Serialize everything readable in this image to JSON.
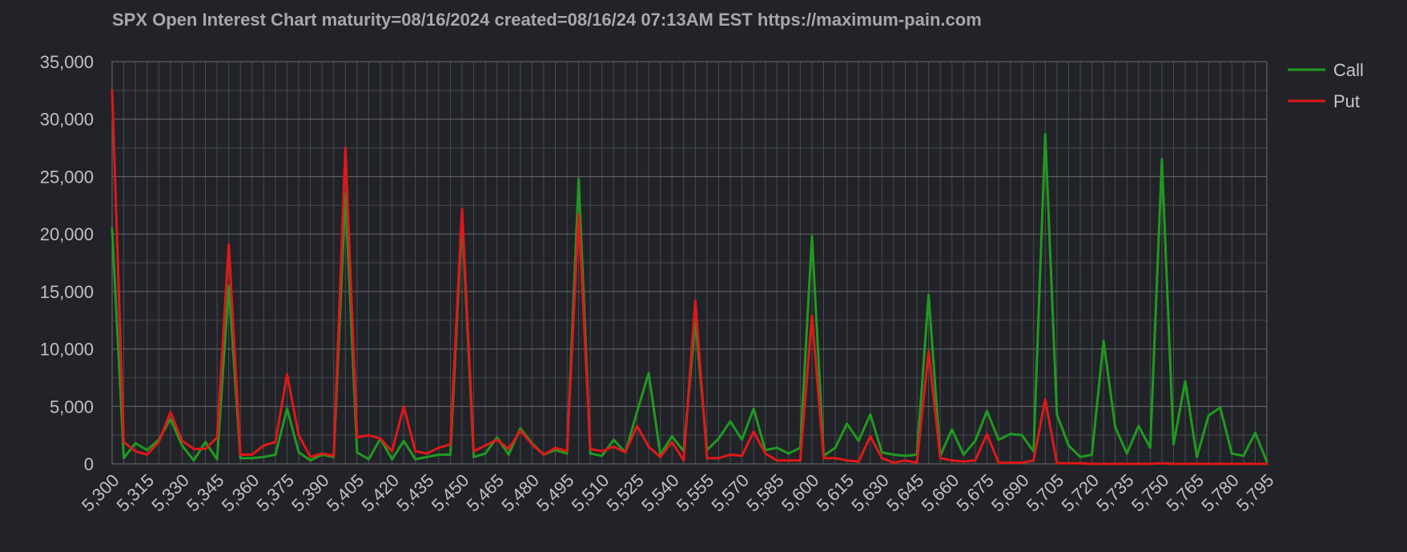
{
  "chart_data": {
    "type": "line",
    "title": "SPX Open Interest Chart maturity=08/16/2024 created=08/16/24 07:13AM EST https://maximum-pain.com",
    "xlabel": "",
    "ylabel": "",
    "ylim": [
      0,
      35000
    ],
    "y_ticks": [
      0,
      5000,
      10000,
      15000,
      20000,
      25000,
      30000,
      35000
    ],
    "x_start": 5300,
    "x_step": 5,
    "x_end": 5795,
    "x_tick_every": 15,
    "grid": true,
    "legend_position": "top-right",
    "series": [
      {
        "name": "Call",
        "color": "#1f9a1f",
        "values": [
          20500,
          500,
          1800,
          1200,
          2100,
          3900,
          1600,
          300,
          1900,
          400,
          15500,
          500,
          500,
          600,
          800,
          4800,
          1000,
          300,
          800,
          600,
          23500,
          1000,
          400,
          2200,
          400,
          2000,
          400,
          600,
          800,
          800,
          21500,
          600,
          900,
          2300,
          800,
          3100,
          1800,
          800,
          1200,
          900,
          24800,
          900,
          700,
          2100,
          1000,
          4500,
          7900,
          800,
          2400,
          1100,
          12500,
          1200,
          2200,
          3700,
          2100,
          4800,
          1200,
          1400,
          900,
          1400,
          19800,
          700,
          1400,
          3500,
          2000,
          4300,
          1000,
          800,
          700,
          800,
          14700,
          700,
          3000,
          800,
          2000,
          4600,
          2100,
          2600,
          2500,
          1100,
          28700,
          4300,
          1600,
          600,
          800,
          10700,
          3200,
          900,
          3300,
          1400,
          26500,
          1700,
          7200,
          600,
          4200,
          4900,
          900,
          700,
          2700,
          200
        ]
      },
      {
        "name": "Put",
        "color": "#e01818",
        "values": [
          32500,
          1900,
          1100,
          800,
          1900,
          4500,
          2000,
          1300,
          1300,
          2300,
          19100,
          800,
          800,
          1600,
          1900,
          7800,
          2500,
          600,
          900,
          700,
          27500,
          2300,
          2500,
          2200,
          1100,
          5000,
          1100,
          900,
          1400,
          1700,
          22200,
          1100,
          1600,
          2100,
          1300,
          2900,
          1700,
          800,
          1400,
          1100,
          21700,
          1300,
          1100,
          1500,
          1000,
          3300,
          1500,
          600,
          1900,
          300,
          14200,
          500,
          500,
          800,
          700,
          2800,
          900,
          300,
          300,
          300,
          12900,
          500,
          500,
          300,
          200,
          2400,
          500,
          100,
          300,
          100,
          9800,
          500,
          300,
          200,
          300,
          2600,
          100,
          100,
          100,
          300,
          5600,
          50,
          50,
          50,
          0,
          0,
          0,
          0,
          0,
          0,
          50,
          0,
          0,
          0,
          0,
          0,
          0,
          0,
          0,
          0
        ]
      }
    ]
  }
}
